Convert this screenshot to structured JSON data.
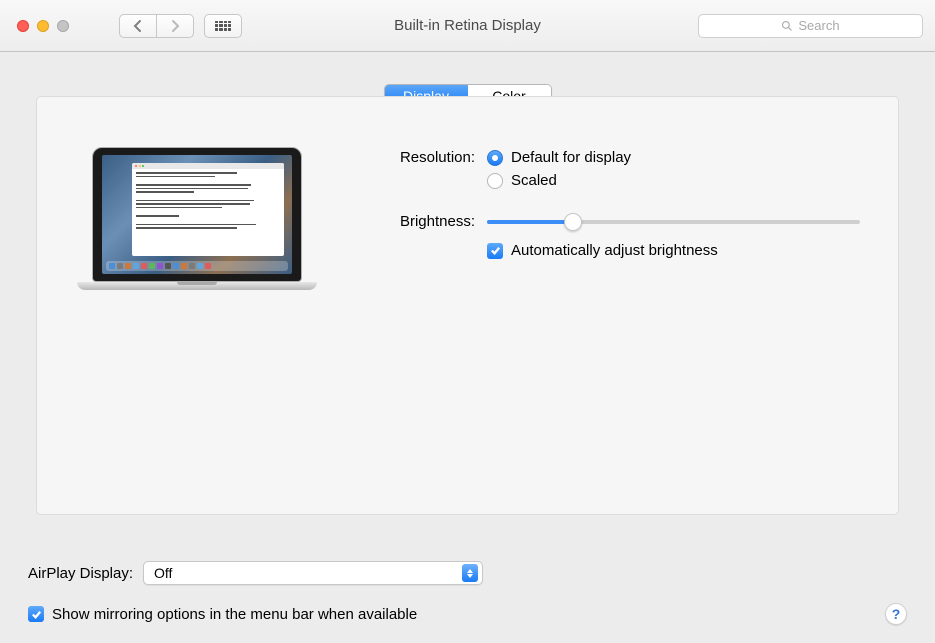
{
  "window": {
    "title": "Built-in Retina Display"
  },
  "search": {
    "placeholder": "Search"
  },
  "tabs": {
    "display": "Display",
    "color": "Color"
  },
  "settings": {
    "resolution_label": "Resolution:",
    "radio_default": "Default for display",
    "radio_scaled": "Scaled",
    "brightness_label": "Brightness:",
    "brightness_value": 23,
    "auto_brightness_label": "Automatically adjust brightness"
  },
  "airplay": {
    "label": "AirPlay Display:",
    "value": "Off"
  },
  "mirroring": {
    "label": "Show mirroring options in the menu bar when available"
  },
  "help": {
    "label": "?"
  }
}
